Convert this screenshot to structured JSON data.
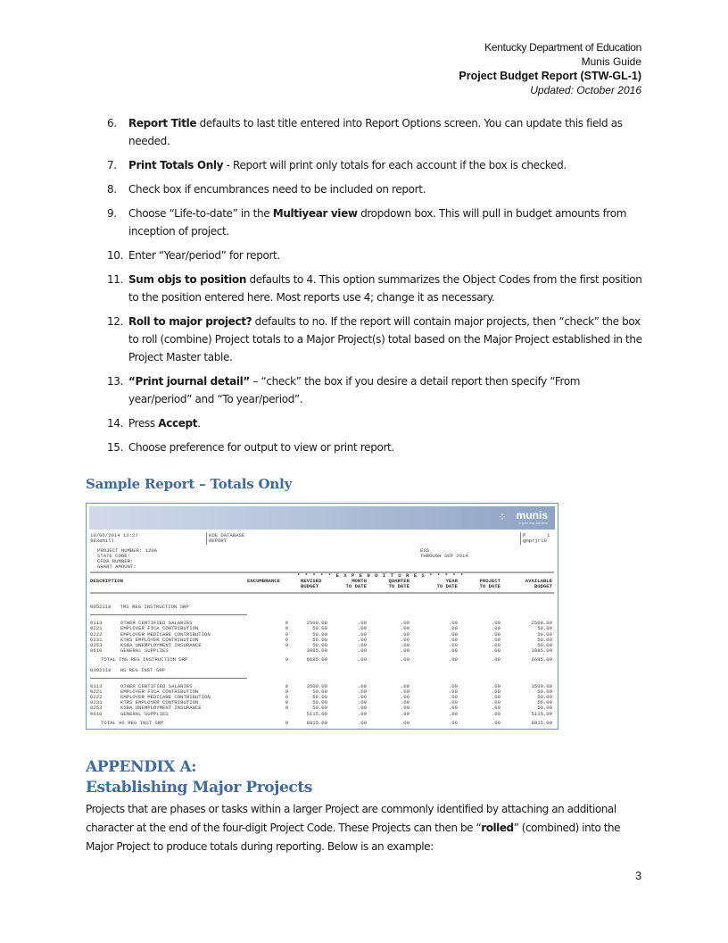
{
  "header": {
    "organization": "Kentucky Department of Education",
    "guide": "Munis Guide",
    "doc_title": "Project Budget Report (STW-GL-1)",
    "updated": "Updated: October 2016"
  },
  "steps": [
    {
      "num": "6.",
      "bold": "Report Title",
      "text": " defaults to last title entered into Report Options screen.  You can update this field as needed."
    },
    {
      "num": "7.",
      "bold": "Print Totals Only",
      "text": " - Report will print only totals for each account if the box is checked."
    },
    {
      "num": "8.",
      "bold": "",
      "text": "Check box if encumbrances need to be included on report."
    },
    {
      "num": "9.",
      "pre": "Choose “Life-to-date” in the ",
      "bold": "Multiyear view",
      "text": " dropdown box.  This will pull in budget amounts from inception of project."
    },
    {
      "num": "10.",
      "bold": "",
      "text": "Enter “Year/period” for report."
    },
    {
      "num": "11.",
      "bold": "Sum objs to position",
      "text": " defaults to 4.  This option summarizes the Object Codes from the first position to the position entered here.  Most reports use 4; change it as necessary."
    },
    {
      "num": "12.",
      "bold": "Roll to major project?",
      "text": " defaults to no.  If the report will contain major projects, then “check” the box to roll (combine) Project totals to a Major Project(s) total based on the Major Project established in the Project Master table."
    },
    {
      "num": "13.",
      "bold": "“Print journal detail”",
      "text": " – “check” the box if you desire a detail report then specify “From year/period” and “To year/period”."
    },
    {
      "num": "14.",
      "pre": "Press ",
      "bold": "Accept",
      "text": "."
    },
    {
      "num": "15.",
      "bold": "",
      "text": "Choose preference for output to view or print report."
    }
  ],
  "sample_heading": "Sample  Report – Totals Only",
  "report": {
    "logo": "munis",
    "logo_tagline": "a tyler erp solution",
    "run_datetime": "10/06/2014 13:27",
    "user": "983emill",
    "db_line1": "KDE DATABASE",
    "db_line2": "REPORT",
    "page_label": "P",
    "page_num": "1",
    "program": "gmprjr10",
    "project_number": "PROJECT NUMBER: 120A",
    "state_code": "STATE CODE:",
    "cfda_number": "CFDA NUMBER:",
    "grant_amount": "GRANT AMOUNT:",
    "ess": "ESS",
    "through": "THROUGH SEP 2014",
    "expenditures_banner": "* * * * * E X P E N D I T U R E S * * * * *",
    "columns": {
      "description": "DESCRIPTION",
      "encumbrance": "ENCUMBRANCE",
      "revised": [
        "REVISED",
        "BUDGET"
      ],
      "month": [
        "MONTH",
        "TO DATE"
      ],
      "quarter": [
        "QUARTER",
        "TO DATE"
      ],
      "year": [
        "YEAR",
        "TO DATE"
      ],
      "project": [
        "PROJECT",
        "TO DATE"
      ],
      "available": [
        "AVAILABLE",
        "BUDGET"
      ]
    },
    "groups": [
      {
        "header": "0052118   TMS REG INSTRUCTION SRP",
        "rows": [
          {
            "code": "0113",
            "desc": "OTHER CERTIFIED SALARIES",
            "enc": "0",
            "rev": "2500.00",
            "mtd": ".00",
            "qtd": ".00",
            "ytd": ".00",
            "ptd": ".00",
            "avl": "2500.00"
          },
          {
            "code": "0221",
            "desc": "EMPLOYER FICA CONTRIBUTION",
            "enc": "0",
            "rev": "50.00",
            "mtd": ".00",
            "qtd": ".00",
            "ytd": ".00",
            "ptd": ".00",
            "avl": "50.00"
          },
          {
            "code": "0222",
            "desc": "EMPLOYER MEDICARE CONTRIBUTION",
            "enc": "0",
            "rev": "50.00",
            "mtd": ".00",
            "qtd": ".00",
            "ytd": ".00",
            "ptd": ".00",
            "avl": "50.00"
          },
          {
            "code": "0231",
            "desc": "KTRS EMPLOYER CONTRIBUTION",
            "enc": "0",
            "rev": "50.00",
            "mtd": ".00",
            "qtd": ".00",
            "ytd": ".00",
            "ptd": ".00",
            "avl": "50.00"
          },
          {
            "code": "0253",
            "desc": "KSBA UNEMPLOYMENT INSURANCE",
            "enc": "0",
            "rev": "50.00",
            "mtd": ".00",
            "qtd": ".00",
            "ytd": ".00",
            "ptd": ".00",
            "avl": "50.00"
          },
          {
            "code": "0610",
            "desc": "GENERAL SUPPLIES",
            "enc": "",
            "rev": "3985.00",
            "mtd": ".00",
            "qtd": ".00",
            "ytd": ".00",
            "ptd": ".00",
            "avl": "3985.00"
          }
        ],
        "total": {
          "label": "TOTAL TMS REG INSTRUCTION SRP",
          "enc": "0",
          "rev": "6685.00",
          "mtd": ".00",
          "qtd": ".00",
          "ytd": ".00",
          "ptd": ".00",
          "avl": "6685.00"
        }
      },
      {
        "header": "0302118   HS REG INST SRP",
        "rows": [
          {
            "code": "0113",
            "desc": "OTHER CERTIFIED SALARIES",
            "enc": "0",
            "rev": "3500.00",
            "mtd": ".00",
            "qtd": ".00",
            "ytd": ".00",
            "ptd": ".00",
            "avl": "3500.00"
          },
          {
            "code": "0221",
            "desc": "EMPLOYER FICA CONTRIBUTION",
            "enc": "0",
            "rev": "50.00",
            "mtd": ".00",
            "qtd": ".00",
            "ytd": ".00",
            "ptd": ".00",
            "avl": "50.00"
          },
          {
            "code": "0222",
            "desc": "EMPLOYER MEDICARE CONTRIBUTION",
            "enc": "0",
            "rev": "50.00",
            "mtd": ".00",
            "qtd": ".00",
            "ytd": ".00",
            "ptd": ".00",
            "avl": "50.00"
          },
          {
            "code": "0231",
            "desc": "KTRS EMPLOYER CONTRIBUTION",
            "enc": "0",
            "rev": "50.00",
            "mtd": ".00",
            "qtd": ".00",
            "ytd": ".00",
            "ptd": ".00",
            "avl": "50.00"
          },
          {
            "code": "0253",
            "desc": "KSBA UNEMPLOYMENT INSURANCE",
            "enc": "0",
            "rev": "50.00",
            "mtd": ".00",
            "qtd": ".00",
            "ytd": ".00",
            "ptd": ".00",
            "avl": "50.00"
          },
          {
            "code": "0610",
            "desc": "GENERAL SUPPLIES",
            "enc": "",
            "rev": "5115.00",
            "mtd": ".00",
            "qtd": ".00",
            "ytd": ".00",
            "ptd": ".00",
            "avl": "5115.00"
          }
        ],
        "total": {
          "label": "TOTAL HS REG INST SRP",
          "enc": "0",
          "rev": "8815.00",
          "mtd": ".00",
          "qtd": ".00",
          "ytd": ".00",
          "ptd": ".00",
          "avl": "8815.00"
        }
      }
    ]
  },
  "appendix": {
    "heading_line1": "APPENDIX A:",
    "heading_line2": "Establishing Major Projects",
    "para_pre": "Projects that are phases or tasks within a larger Project are commonly identified by attaching an additional character at the end of the four-digit Project Code.  These Projects can then be “",
    "para_bold": "rolled",
    "para_post": "” (combined) into the Major Project to produce totals during reporting.  Below is an example:"
  },
  "page_number": "3"
}
